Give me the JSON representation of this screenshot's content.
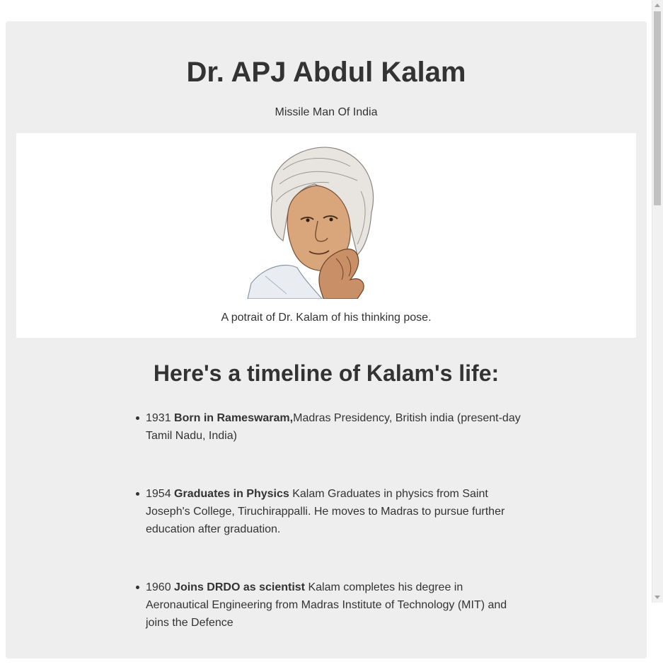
{
  "header": {
    "title": "Dr. APJ Abdul Kalam",
    "subtitle": "Missile Man Of India"
  },
  "image": {
    "caption": "A potrait of Dr. Kalam of his thinking pose.",
    "icon": "portrait-illustration"
  },
  "timeline": {
    "heading": "Here's a timeline of Kalam's life:",
    "items": [
      {
        "year": "1931",
        "title": "Born in Rameswaram,",
        "text": "Madras Presidency, British india (present-day Tamil Nadu, India)"
      },
      {
        "year": "1954",
        "title": "Graduates in Physics",
        "text": "Kalam Graduates in physics from Saint Joseph's College, Tiruchirappalli. He moves to Madras to pursue further education after graduation."
      },
      {
        "year": "1960",
        "title": "Joins DRDO as scientist",
        "text": "Kalam completes his degree in Aeronautical Engineering from Madras Institute of Technology (MIT) and joins the Defence"
      }
    ]
  },
  "colors": {
    "background": "#eeeeee",
    "card": "#ffffff",
    "text": "#333333"
  }
}
